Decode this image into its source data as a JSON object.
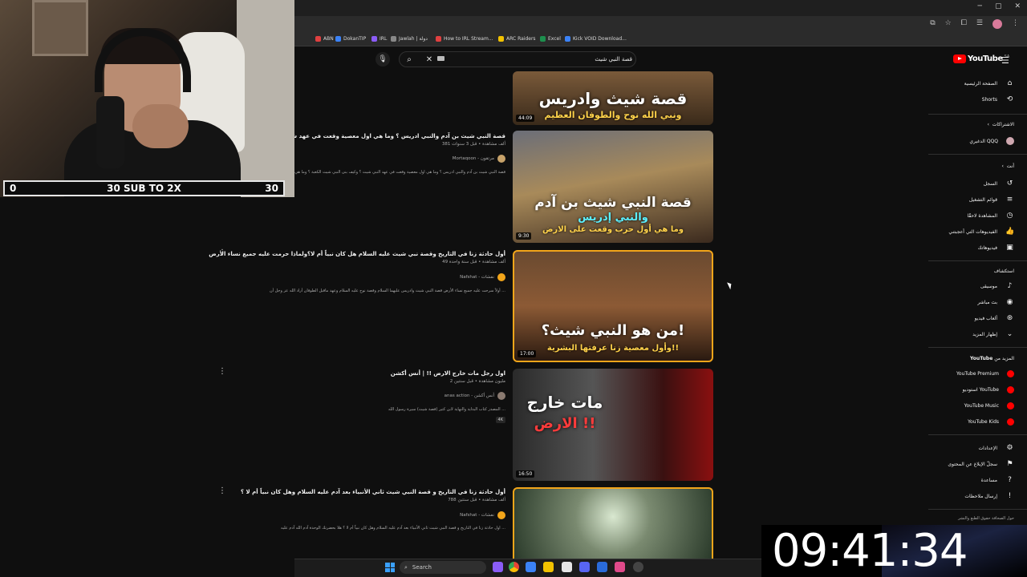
{
  "browser": {
    "bookmarks": [
      {
        "label": "ABN",
        "color": "#e04040"
      },
      {
        "label": "DokanTIP",
        "color": "#3b82f6"
      },
      {
        "label": "IRL",
        "color": "#8b5cf6"
      },
      {
        "label": "Jawlah | دولة",
        "color": "#888888"
      },
      {
        "label": "How to IRL Stream...",
        "color": "#e04040"
      },
      {
        "label": "ARC Raiders",
        "color": "#f2c200"
      },
      {
        "label": "Excel",
        "color": "#1d8f4e"
      },
      {
        "label": "Kick VOID Download...",
        "color": "#3b82f6"
      }
    ]
  },
  "stream": {
    "sub_left": "0",
    "sub_center": "30 SUB TO 2X",
    "sub_right": "30",
    "clock": "09:41:34"
  },
  "search": {
    "query": "قصة النبي شيث"
  },
  "logo": {
    "word": "YouTube",
    "country": "SA"
  },
  "sidebar": {
    "home": "الصفحة الرئيسية",
    "shorts": "Shorts",
    "subscriptions_head": "الاشتراكات",
    "subscription_channel": "الدغيري QQQ",
    "you_head": "أنت",
    "history": "السجل",
    "playlists": "قوائم التشغيل",
    "watch_later": "المشاهدة لاحقًا",
    "your_videos": "الفيديوهات التي أعجبتني",
    "downloads": "فيديوهاتك",
    "explore_head": "استكشاف",
    "music": "موسيقى",
    "live": "بث مباشر",
    "gaming": "ألعاب فيديو",
    "show_more": "إظهار المزيد",
    "more_head_prefix": "المزيد من",
    "more_head_brand": "YouTube",
    "premium": "YouTube Premium",
    "studio": "استوديو YouTube",
    "music_app": "YouTube Music",
    "kids": "YouTube Kids",
    "settings": "الإعدادات",
    "report": "سجلّ الإبلاغ عن المحتوى",
    "help": "مساعدة",
    "feedback": "إرسال ملاحظات",
    "footer": "حول  الصحافة  حقوق الطبع والنشر"
  },
  "results": [
    {
      "duration": "44:09",
      "thumb_line1": "قصة شيث وادريس",
      "thumb_line2": "ونبي الله نوح والطوفان العظيم"
    },
    {
      "title": "قصة النبي شيث بن آدم والنبي ادريس ؟ وما هي اول معصية وقعت في عهد شيث ؟ وما هي اول",
      "meta": "381 ألف مشاهدة • قبل 3 سنوات",
      "channel": "Mortaqoon - مرتقون",
      "desc": "قصة النبي شيث بن آدم والنبي ادريس ؟ وما هي اول معصية وقعت في عهد النبي شيث ؟ وكيف بنى النبي شيث الكعبة ؟ وما هي اول حرب",
      "duration": "9:30",
      "thumb_line1": "قصة النبي شيث بن آدم",
      "thumb_line2": "والنبي إدريس",
      "thumb_line3": "وما هي أول حرب وقعت على الارض"
    },
    {
      "title": "أول حادثة زنا في التاريخ وقصة نبي شيث عليه السلام هل كان نبياً أم لا؟ولماذا حرمت عليه جميع نساء الأرض",
      "meta": "49 ألف مشاهدة • قبل سنة واحدة",
      "channel": "Nafshat - نفشات",
      "desc": "أولاً سرحت عليه جميع نساء الأرض قصة النبي شيث وادريس عليهما السلام وقصة نوح عليه السلام وعهد ماقبل الطوفان أراد الله عز وجل أن ...",
      "duration": "17:00",
      "thumb_line1": "من هو النبي شيث؟!",
      "thumb_line2": "وأول معصية زنا عرفتها البشرية!!"
    },
    {
      "title": "اول رجل مات خارج الارض !! | أنس أكشن",
      "meta": "2 مليون مشاهدة • قبل سنتين",
      "channel": "anas action - أنس أكشن",
      "desc": "المصدر كتاب البداية والنهاية لابن كثير (قصة شيث) سيرة رسول الله ...",
      "badge": "4K",
      "duration": "16:50",
      "thumb_line1": "مات خارج",
      "thumb_line2": "الارض !!"
    },
    {
      "title": "أول حادثة زنا في التاريخ و قصة النبي شيث ثاني الأنبياء بعد آدم عليه السلام وهل كان نبياً أم لا ؟",
      "meta": "788 ألف مشاهدة • قبل سنتين",
      "channel": "Nafshat - نفشات",
      "desc": "اول حادثة زنا في التاريخ و قصة النبي شيث ثاني الأنبياء بعد آدم عليه السلام وهل كان نبياً أم لا ؟ هلا بحضرتك الوحدة آدم الله آدم عليه ..."
    }
  ],
  "taskbar": {
    "search_label": "Search"
  }
}
